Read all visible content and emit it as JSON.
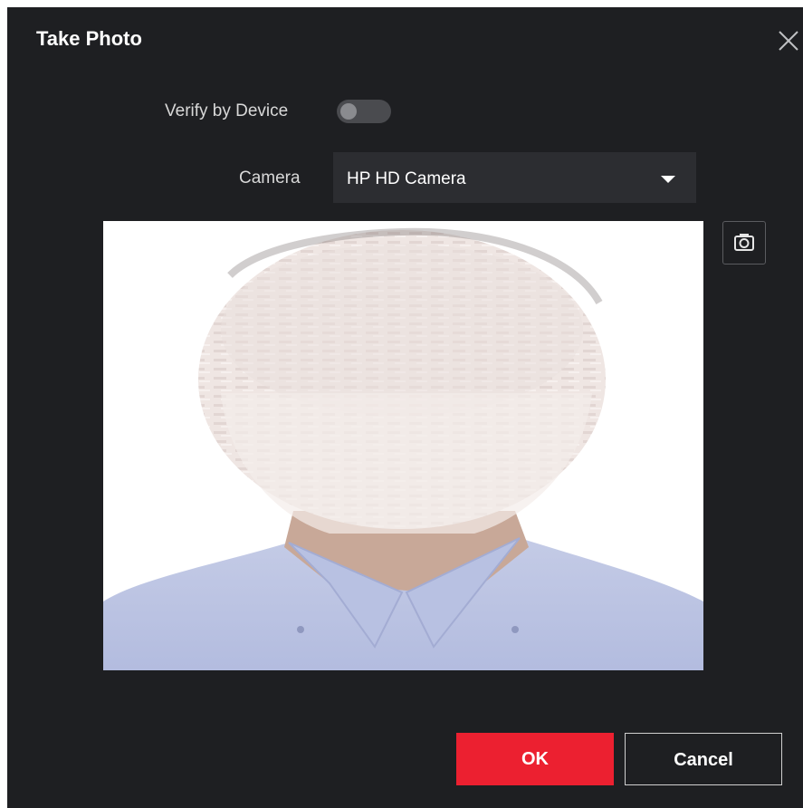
{
  "dialog": {
    "title": "Take Photo",
    "close_icon": "close-icon"
  },
  "verify": {
    "label": "Verify by Device",
    "enabled": false
  },
  "camera": {
    "label": "Camera",
    "selected": "HP HD Camera",
    "dropdown_icon": "chevron-down-icon"
  },
  "preview": {
    "snapshot_icon": "camera-icon"
  },
  "buttons": {
    "ok_label": "OK",
    "cancel_label": "Cancel"
  },
  "colors": {
    "background": "#1e1f22",
    "accent": "#ec2030",
    "input_bg": "#2c2d31",
    "toggle_off": "#4a4b4f"
  }
}
